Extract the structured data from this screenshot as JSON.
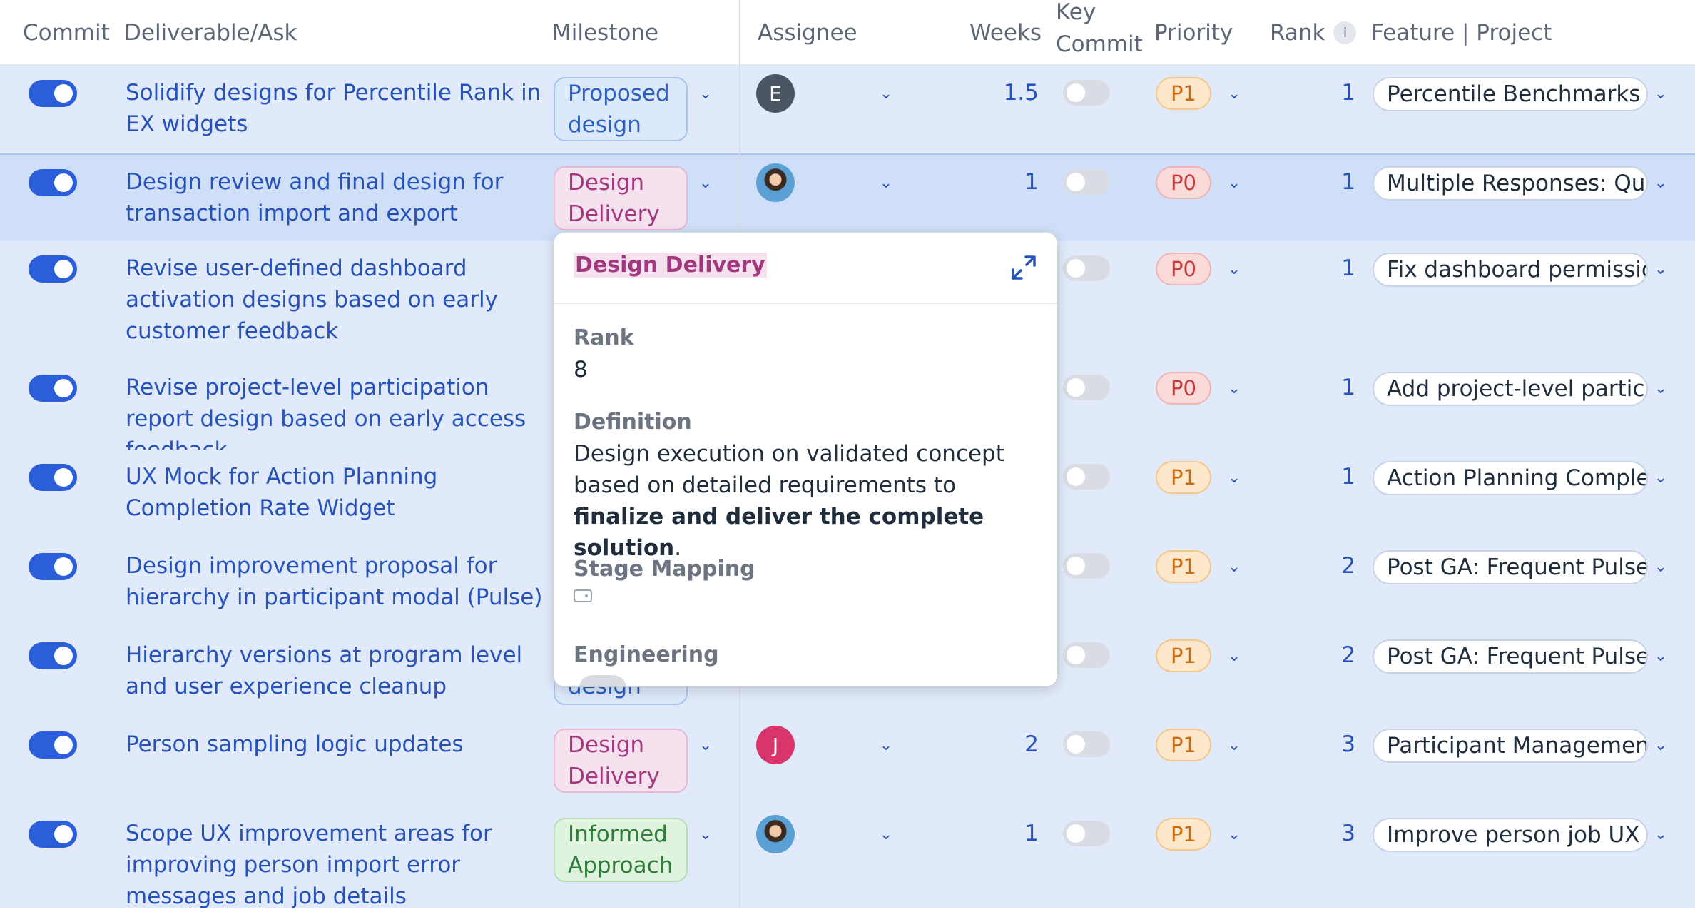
{
  "header": {
    "commit": "Commit",
    "deliverable": "Deliverable/Ask",
    "milestone": "Milestone",
    "assignee": "Assignee",
    "weeks": "Weeks",
    "key_commit": "Key Commit",
    "priority": "Priority",
    "rank": "Rank",
    "feature_project": "Feature | Project"
  },
  "rows": [
    {
      "title": "Solidify designs for Percentile Rank in EX widgets",
      "milestone": "Proposed design",
      "assignee": "E",
      "weeks": "1.5",
      "priority": "P1",
      "rank": "1",
      "feature": "Percentile Benchmarks in"
    },
    {
      "title": "Design review and final design for transaction import and export",
      "milestone": "Design Delivery",
      "assignee": "",
      "weeks": "1",
      "priority": "P0",
      "rank": "1",
      "feature": "Multiple Responses: Quali"
    },
    {
      "title": "Revise user-defined dashboard activation designs based on early customer feedback",
      "milestone": "",
      "assignee": "",
      "weeks": "",
      "priority": "P0",
      "rank": "1",
      "feature": "Fix dashboard permission"
    },
    {
      "title": "Revise project-level participation report design based on early access feedback",
      "milestone": "",
      "assignee": "",
      "weeks": "",
      "priority": "P0",
      "rank": "1",
      "feature": "Add project-level particip"
    },
    {
      "title": "UX Mock for Action Planning Completion Rate Widget",
      "milestone": "",
      "assignee": "",
      "weeks": "",
      "priority": "P1",
      "rank": "1",
      "feature": "Action Planning Completic"
    },
    {
      "title": "Design improvement proposal for hierarchy in participant modal (Pulse)",
      "milestone": "",
      "assignee": "",
      "weeks": "",
      "priority": "P1",
      "rank": "2",
      "feature": "Post GA: Frequent Pulse"
    },
    {
      "title": "Hierarchy versions at program level and user experience cleanup",
      "milestone": "design",
      "assignee": "",
      "weeks": "",
      "priority": "P1",
      "rank": "2",
      "feature": "Post GA: Frequent Pulse"
    },
    {
      "title": "Person sampling logic updates",
      "milestone": "Design Delivery",
      "assignee": "J",
      "weeks": "2",
      "priority": "P1",
      "rank": "3",
      "feature": "Participant Management I"
    },
    {
      "title": "Scope UX improvement areas for improving person import error messages and job details",
      "milestone": "Informed Approach",
      "assignee": "",
      "weeks": "1",
      "priority": "P1",
      "rank": "3",
      "feature": "Improve person job UX flo"
    }
  ],
  "popup": {
    "title": "Design Delivery",
    "rank_label": "Rank",
    "rank_value": "8",
    "definition_label": "Definition",
    "definition_text_1": "Design execution on validated concept based on detailed requirements to ",
    "definition_bold": "finalize and deliver the complete solution",
    "definition_text_2": ".",
    "stage_label": "Stage Mapping",
    "engineering_label": "Engineering"
  },
  "colors": {
    "accent": "#2b5fd9",
    "row_bg": "#e1eafb",
    "p1": "#c96a15",
    "p0": "#c43b3b",
    "design_delivery": "#a2397f"
  }
}
